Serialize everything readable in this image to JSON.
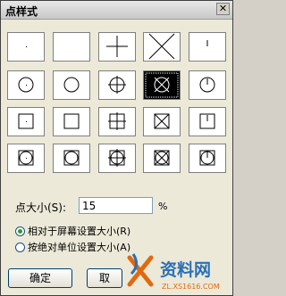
{
  "window": {
    "title": "点样式",
    "close_glyph": "✕"
  },
  "styles": [
    {
      "icon": "dot"
    },
    {
      "icon": "none"
    },
    {
      "icon": "plus"
    },
    {
      "icon": "x"
    },
    {
      "icon": "tick"
    },
    {
      "icon": "circle-dot"
    },
    {
      "icon": "circle"
    },
    {
      "icon": "circle-plus"
    },
    {
      "icon": "circle-x",
      "selected": true
    },
    {
      "icon": "circle-tick"
    },
    {
      "icon": "square-dot"
    },
    {
      "icon": "square"
    },
    {
      "icon": "square-plus"
    },
    {
      "icon": "square-x"
    },
    {
      "icon": "square-tick"
    },
    {
      "icon": "square-circle-dot"
    },
    {
      "icon": "square-circle"
    },
    {
      "icon": "square-circle-plus"
    },
    {
      "icon": "square-circle-x"
    },
    {
      "icon": "square-circle-tick"
    }
  ],
  "point_size": {
    "label": "点大小(S):",
    "value": "15",
    "unit": "%"
  },
  "options": {
    "relative_label": "相对于屏幕设置大小(R)",
    "absolute_label": "按绝对单位设置大小(A)",
    "selected": "relative"
  },
  "buttons": {
    "ok": "确定",
    "cancel": "取"
  },
  "watermark": {
    "text": "资料网",
    "url": "ZL.XS1616.COM"
  },
  "colors": {
    "selected_bg": "#000000",
    "radio_dot": "#2a9a2a",
    "watermark_orange": "#e06a10"
  }
}
